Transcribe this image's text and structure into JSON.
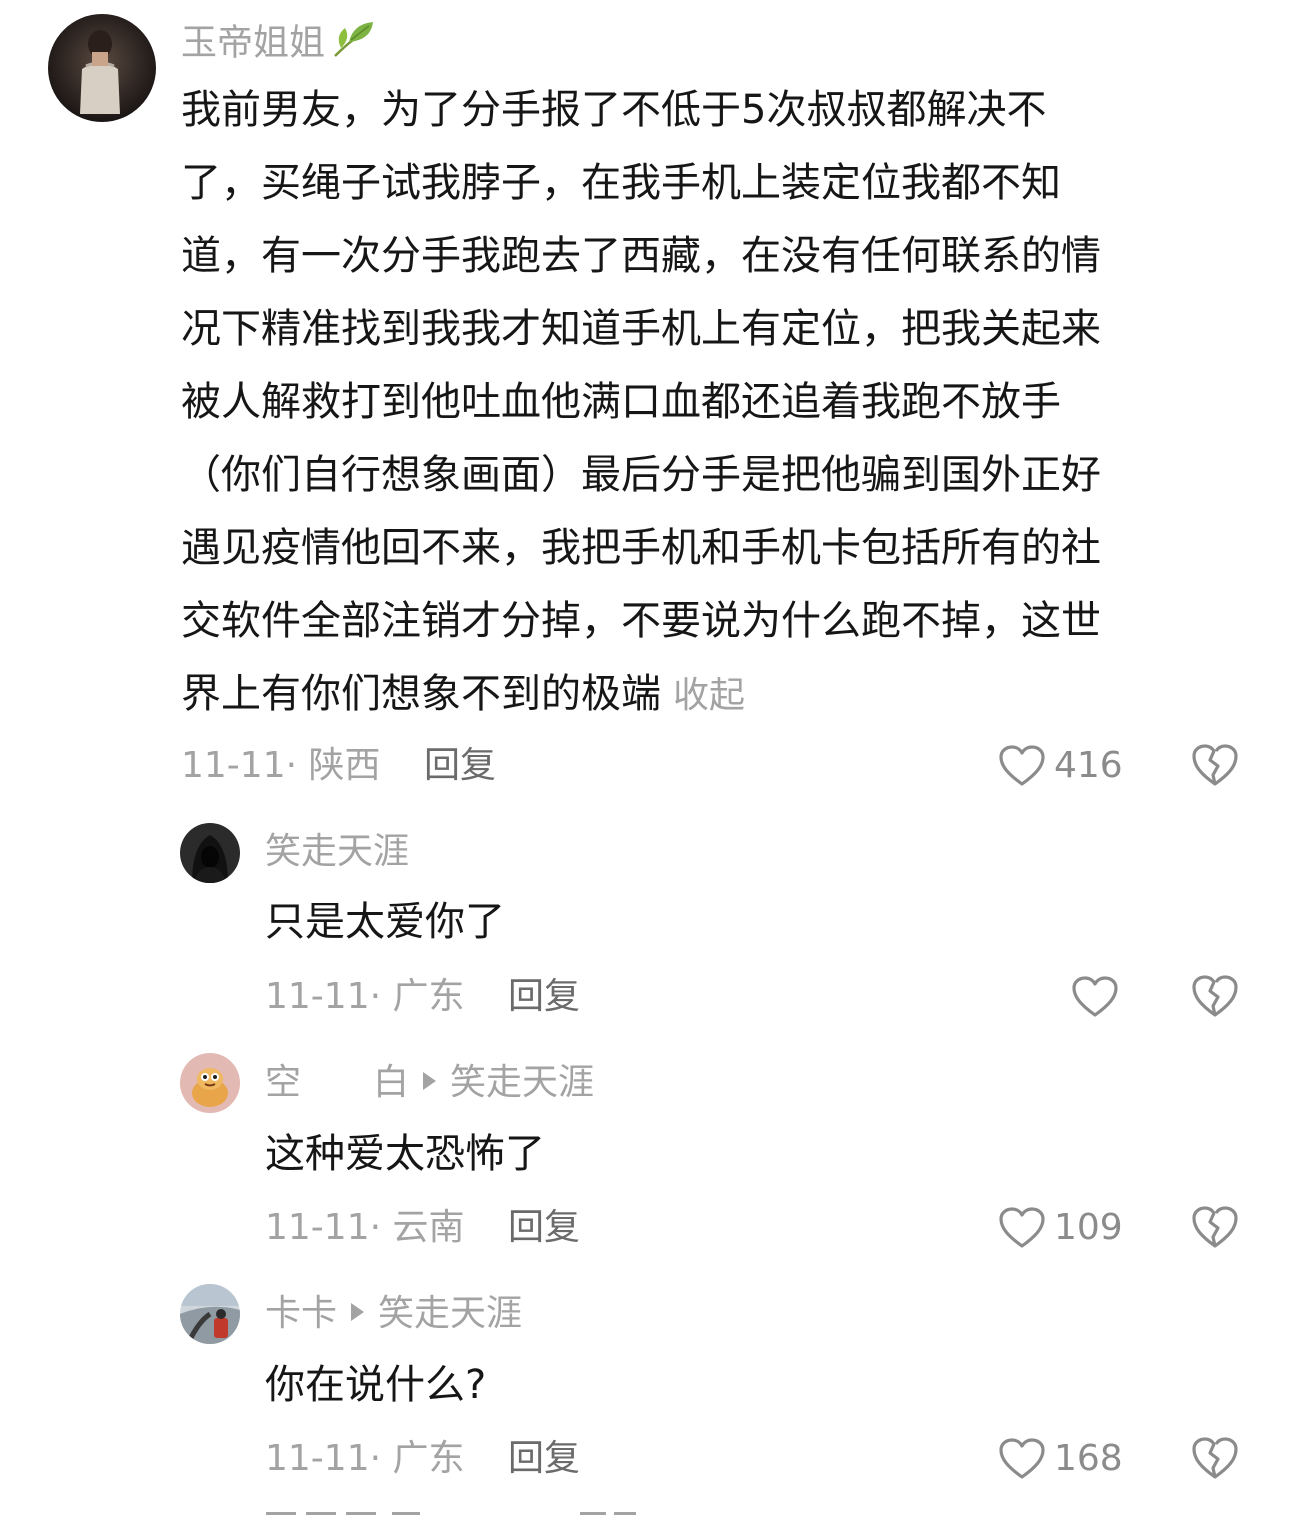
{
  "comment": {
    "username": "玉帝姐姐",
    "username_icon": "leaf-icon",
    "lines": [
      "我前男友，为了分手报了不低于5次叔叔都解决不",
      "了，买绳子试我脖子，在我手机上装定位我都不知",
      "道，有一次分手我跑去了西藏，在没有任何联系的情",
      "况下精准找到我我才知道手机上有定位，把我关起来",
      "被人解救打到他吐血他满口血都还追着我跑不放手",
      "（你们自行想象画面）最后分手是把他骗到国外正好",
      "遇见疫情他回不来，我把手机和手机卡包括所有的社",
      "交软件全部注销才分掉，不要说为什么跑不掉，这世",
      "界上有你们想象不到的极端"
    ],
    "collapse_label": "收起",
    "meta": "11-11· 陕西",
    "reply_label": "回复",
    "likes": "416"
  },
  "replies": [
    {
      "username": "笑走天涯",
      "reply_to": "",
      "text": "只是太爱你了",
      "meta": "11-11· 广东",
      "reply_label": "回复",
      "likes": ""
    },
    {
      "username": "空　　白",
      "reply_to": "笑走天涯",
      "text": "这种爱太恐怖了",
      "meta": "11-11· 云南",
      "reply_label": "回复",
      "likes": "109"
    },
    {
      "username": "卡卡",
      "reply_to": "笑走天涯",
      "text": "你在说什么?",
      "meta": "11-11· 广东",
      "reply_label": "回复",
      "likes": "168"
    }
  ],
  "colors": {
    "text": "#161616",
    "muted": "#a3a3a3",
    "icon": "#8b8b8b"
  }
}
